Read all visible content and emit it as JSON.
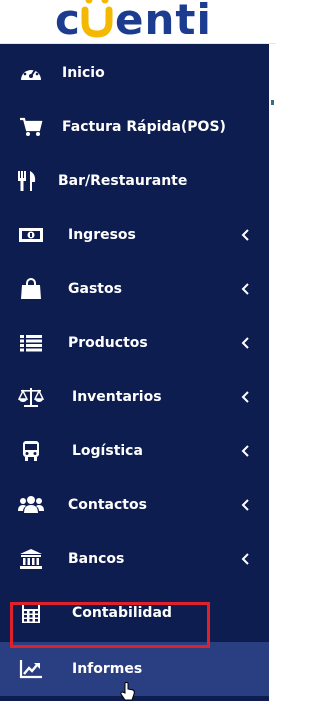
{
  "brand": {
    "logo_text": "cuenti"
  },
  "menu": [
    {
      "label": "Inicio",
      "icon": "dashboard-gauge-icon",
      "has_chevron": false
    },
    {
      "label": "Factura Rápida(POS)",
      "icon": "shopping-cart-icon",
      "has_chevron": false
    },
    {
      "label": "Bar/Restaurante",
      "icon": "fork-knife-icon",
      "has_chevron": false
    },
    {
      "label": "Ingresos",
      "icon": "money-bill-icon",
      "has_chevron": true
    },
    {
      "label": "Gastos",
      "icon": "shopping-bag-icon",
      "has_chevron": true
    },
    {
      "label": "Productos",
      "icon": "list-icon",
      "has_chevron": true
    },
    {
      "label": "Inventarios",
      "icon": "balance-scale-icon",
      "has_chevron": true
    },
    {
      "label": "Logística",
      "icon": "truck-icon",
      "has_chevron": true
    },
    {
      "label": "Contactos",
      "icon": "users-icon",
      "has_chevron": true
    },
    {
      "label": "Bancos",
      "icon": "bank-icon",
      "has_chevron": true
    },
    {
      "label": "Contabilidad",
      "icon": "calculator-icon",
      "has_chevron": false
    },
    {
      "label": "Informes",
      "icon": "line-chart-icon",
      "has_chevron": false,
      "active": true
    }
  ],
  "colors": {
    "sidebar_bg": "#0e1d4f",
    "active_bg": "#2a3f82",
    "highlight_border": "#e0202a",
    "logo_blue": "#1c3d8f",
    "logo_yellow": "#f5b800"
  }
}
